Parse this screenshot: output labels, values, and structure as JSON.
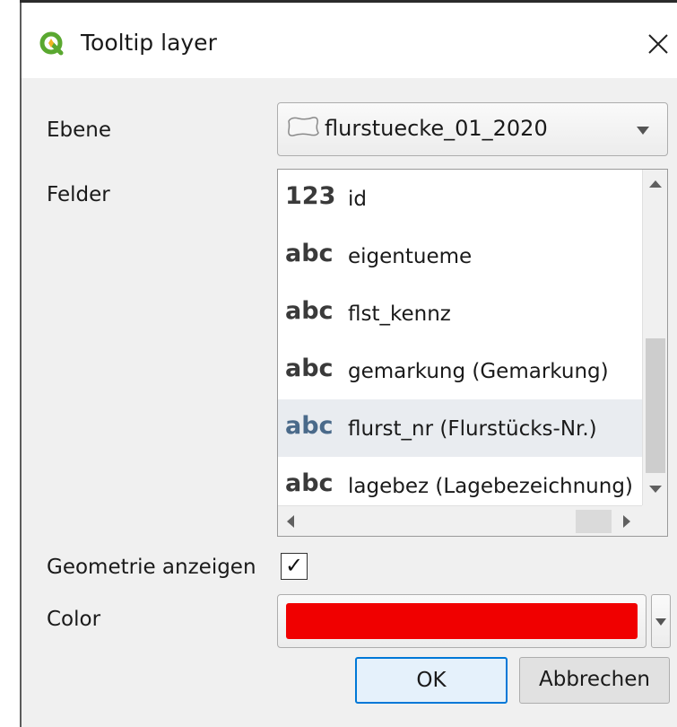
{
  "window": {
    "title": "Tooltip layer",
    "app_icon": "qgis-logo-icon",
    "close_icon": "close-icon"
  },
  "form": {
    "layer_label": "Ebene",
    "layer_value": "flurstuecke_01_2020",
    "layer_icon": "polygon-layer-icon",
    "fields_label": "Felder",
    "fields": [
      {
        "type": "123",
        "name": "id",
        "selected": false
      },
      {
        "type": "abc",
        "name": "eigentueme",
        "selected": false
      },
      {
        "type": "abc",
        "name": "flst_kennz",
        "selected": false
      },
      {
        "type": "abc",
        "name": "gemarkung (Gemarkung)",
        "selected": false
      },
      {
        "type": "abc",
        "name": "flurst_nr (Flurstücks-Nr.)",
        "selected": true
      },
      {
        "type": "abc",
        "name": "lagebez (Lagebezeichnung)",
        "selected": false
      }
    ],
    "geometry_label": "Geometrie anzeigen",
    "geometry_checked": true,
    "color_label": "Color",
    "color_value": "#f00000"
  },
  "buttons": {
    "ok": "OK",
    "cancel": "Abbrechen"
  },
  "colors": {
    "accent": "#0078d7",
    "qgis_green": "#5aa830",
    "qgis_yellow": "#f0b323"
  }
}
